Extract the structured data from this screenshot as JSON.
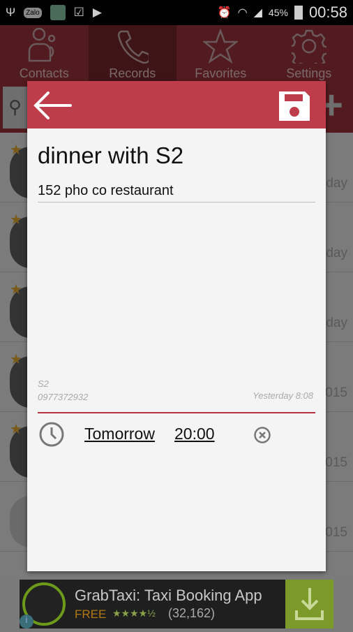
{
  "status_bar": {
    "battery": "45%",
    "time": "00:58",
    "icons": [
      "usb-icon",
      "zalo-icon",
      "app-icon",
      "briefcase-check-icon",
      "briefcase-play-icon",
      "alarm-icon",
      "wifi-icon",
      "signal-icon",
      "battery-charging-icon"
    ],
    "zalo": "Zalo"
  },
  "tabs": [
    {
      "label": "Contacts",
      "icon": "contacts-icon"
    },
    {
      "label": "Records",
      "icon": "phone-icon",
      "active": true
    },
    {
      "label": "Favorites",
      "icon": "star-icon"
    },
    {
      "label": "Settings",
      "icon": "gear-icon"
    }
  ],
  "list": {
    "rows": [
      {
        "when": "day",
        "starred": true
      },
      {
        "when": "day",
        "starred": true
      },
      {
        "when": "day",
        "starred": true
      },
      {
        "when": "015",
        "starred": true
      },
      {
        "when": "015",
        "starred": true
      },
      {
        "when": "015",
        "starred": false
      }
    ]
  },
  "dialog": {
    "title": "dinner with S2",
    "note": "152 pho co restaurant",
    "contact_name": "S2",
    "contact_phone": "0977372932",
    "timestamp": "Yesterday 8:08",
    "reminder_date": "Tomorrow",
    "reminder_time": "20:00",
    "accent": "#bf3d4a"
  },
  "ad": {
    "title": "GrabTaxi: Taxi Booking App",
    "price": "FREE",
    "rating": 4.5,
    "stars": "★★★★½",
    "count": "(32,162)",
    "info": "i"
  }
}
